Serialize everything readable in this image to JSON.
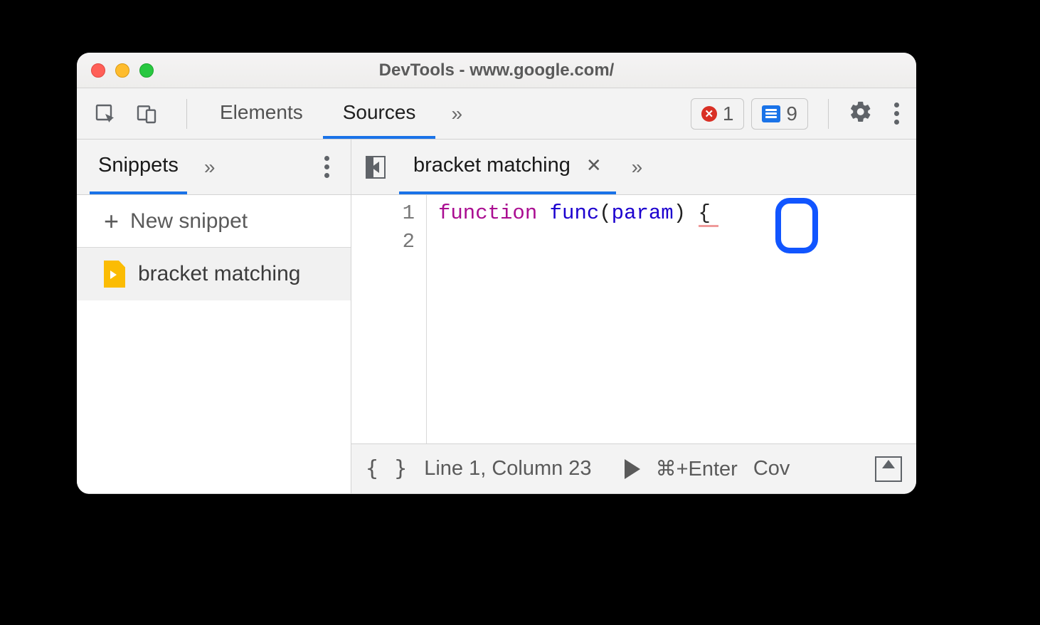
{
  "window_title": "DevTools - www.google.com/",
  "toolbar": {
    "tabs": [
      "Elements",
      "Sources"
    ],
    "active_tab_index": 1,
    "error_count": "1",
    "message_count": "9"
  },
  "left": {
    "tab_label": "Snippets",
    "new_snippet_label": "New snippet",
    "items": [
      "bracket matching"
    ]
  },
  "editor": {
    "open_file": "bracket matching",
    "lines": [
      "1",
      "2"
    ],
    "tokens": {
      "keyword": "function",
      "space1": " ",
      "funcname": "func",
      "open_paren": "(",
      "param": "param",
      "close_paren": ")",
      "space2": " ",
      "brace": "{"
    }
  },
  "status": {
    "format_braces": "{ }",
    "position": "Line 1, Column 23",
    "run_shortcut": "⌘+Enter",
    "coverage_trunc": "Cov"
  }
}
